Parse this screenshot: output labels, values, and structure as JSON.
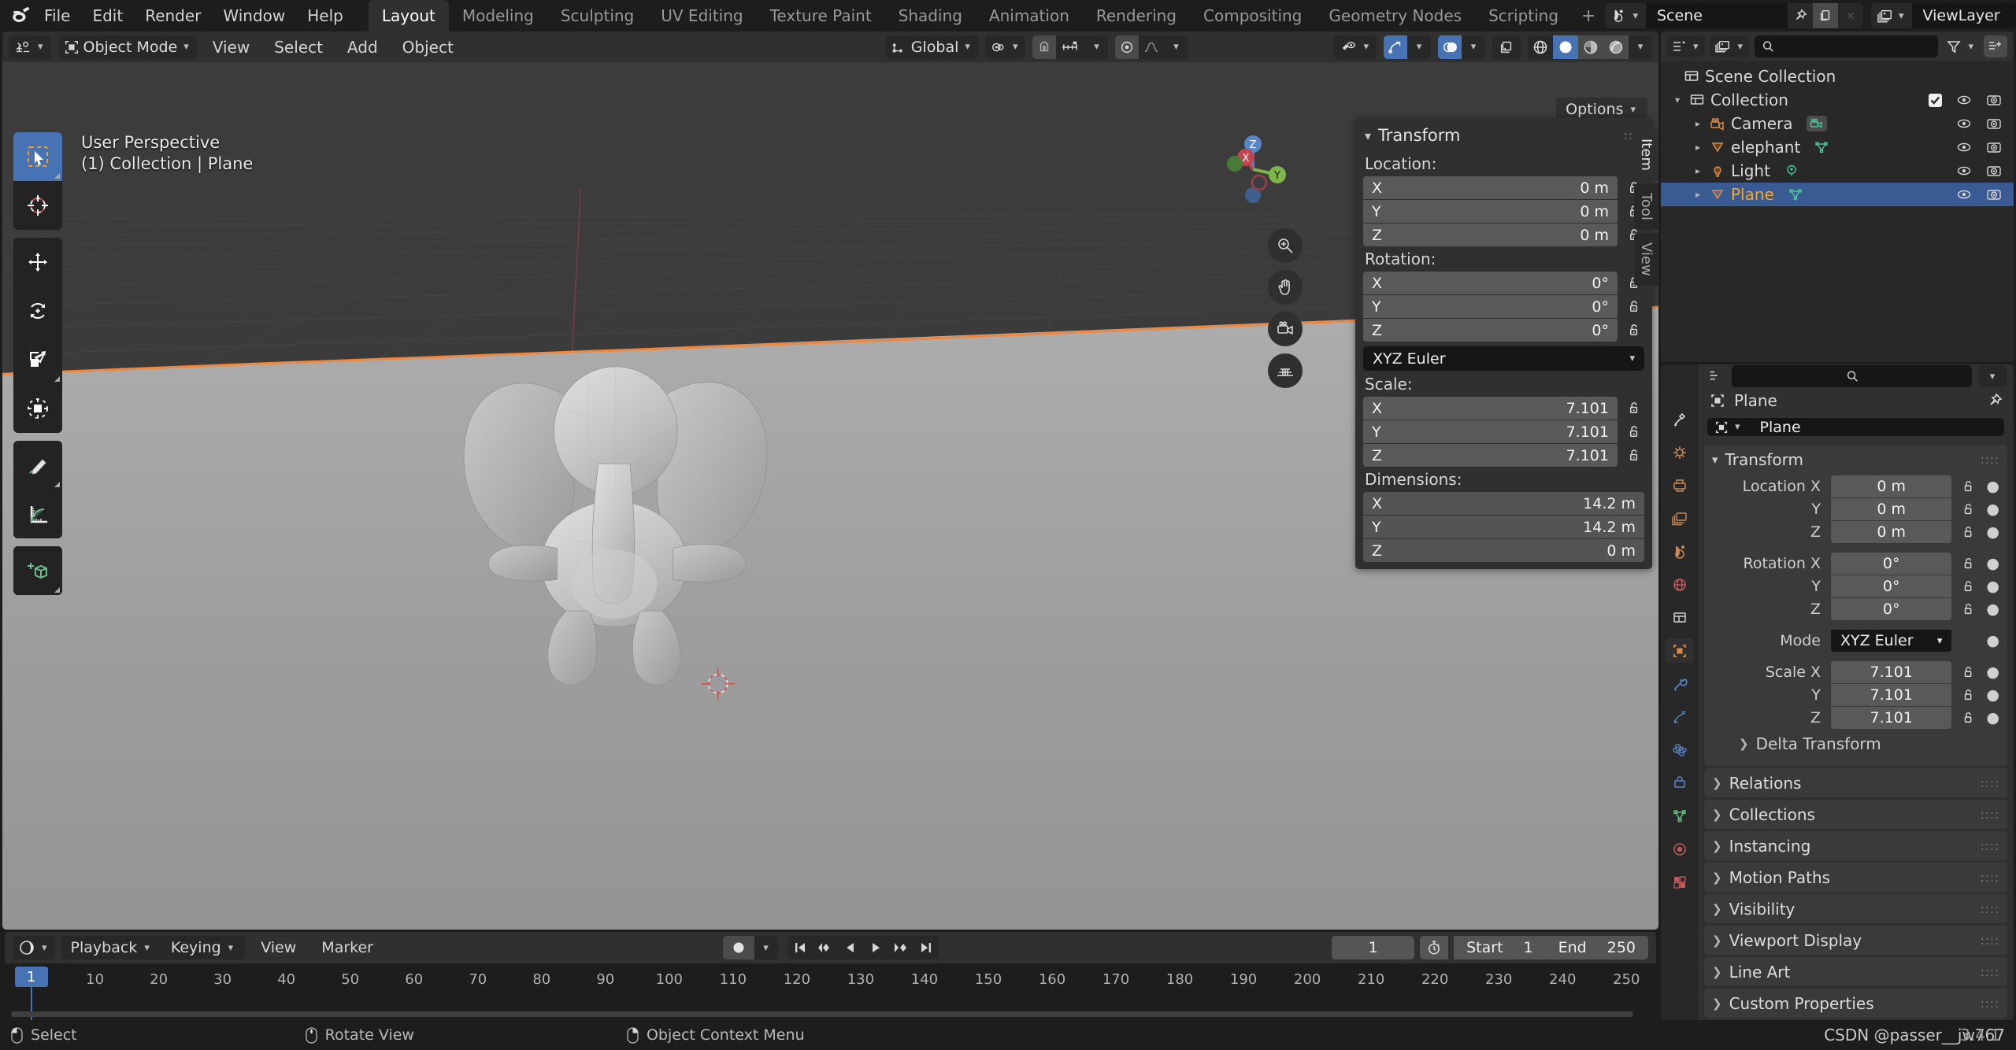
{
  "app": {
    "version": "3.4.1",
    "watermark": "CSDN @passer__jw767"
  },
  "topbar": {
    "logo_icon": "blender-logo-icon",
    "menus": [
      "File",
      "Edit",
      "Render",
      "Window",
      "Help"
    ],
    "workspaces": [
      "Layout",
      "Modeling",
      "Sculpting",
      "UV Editing",
      "Texture Paint",
      "Shading",
      "Animation",
      "Rendering",
      "Compositing",
      "Geometry Nodes",
      "Scripting"
    ],
    "active_workspace": "Layout",
    "add_workspace_label": "+",
    "scene": {
      "label": "Scene",
      "icon": "scene-icon",
      "pin_icon": "pin-icon",
      "copy_icon": "copy-icon",
      "close_icon": "x-icon"
    },
    "viewlayer": {
      "label": "ViewLayer",
      "icon": "viewlayer-icon",
      "copy_icon": "copy-icon",
      "close_icon": "x-icon"
    }
  },
  "viewport": {
    "header": {
      "editor_type_icon": "editor-type-3dview-icon",
      "mode": "Object Mode",
      "mode_icon": "object-mode-icon",
      "menus": [
        "View",
        "Select",
        "Add",
        "Object"
      ],
      "transform_orientation": {
        "label": "Global",
        "icon": "orientation-icon"
      },
      "pivot_icon": "pivot-point-icon",
      "snap_magnet_icon": "snap-magnet-icon",
      "snap_target_icon": "snap-increment-icon",
      "proportional_icon": "proportional-editing-icon",
      "falloff_icon": "falloff-curve-icon",
      "visibility_icon": "object-visibility-icon",
      "gizmo_icon": "gizmo-icon",
      "overlays_icon": "overlays-icon",
      "xray_icon": "xray-toggle-icon",
      "shading_modes": [
        "wireframe",
        "solid",
        "material-preview",
        "rendered"
      ],
      "active_shading": "solid"
    },
    "options_label": "Options",
    "overlay_line1": "User Perspective",
    "overlay_line2": "(1) Collection | Plane",
    "toolbar": [
      {
        "name": "tweak-select-tool",
        "icon": "cursor-arrow-box-icon",
        "active": true
      },
      {
        "name": "cursor-tool",
        "icon": "3d-cursor-icon",
        "active": false
      },
      {
        "name": "move-tool",
        "icon": "move-arrows-icon",
        "active": false
      },
      {
        "name": "rotate-tool",
        "icon": "rotate-arrows-icon",
        "active": false
      },
      {
        "name": "scale-tool",
        "icon": "scale-box-icon",
        "active": false
      },
      {
        "name": "transform-tool",
        "icon": "transform-icon",
        "active": false
      },
      {
        "name": "annotate-tool",
        "icon": "pencil-icon",
        "active": false
      },
      {
        "name": "measure-tool",
        "icon": "ruler-icon",
        "active": false
      },
      {
        "name": "add-cube-tool",
        "icon": "add-cube-icon",
        "active": false
      }
    ],
    "side_buttons": [
      {
        "name": "zoom-view-button",
        "icon": "magnifier-icon"
      },
      {
        "name": "pan-view-button",
        "icon": "hand-icon"
      },
      {
        "name": "camera-view-button",
        "icon": "camera-icon"
      },
      {
        "name": "toggle-ortho-button",
        "icon": "grid-perspective-icon"
      }
    ],
    "gizmo": {
      "x_label": "X",
      "y_label": "Y",
      "z_label": "Z"
    }
  },
  "npanel": {
    "tabs": [
      "Item",
      "Tool",
      "View"
    ],
    "active_tab": "Item",
    "title": "Transform",
    "sections": [
      {
        "label": "Location:",
        "rows": [
          {
            "axis": "X",
            "value": "0 m"
          },
          {
            "axis": "Y",
            "value": "0 m"
          },
          {
            "axis": "Z",
            "value": "0 m"
          }
        ]
      },
      {
        "label": "Rotation:",
        "rows": [
          {
            "axis": "X",
            "value": "0°"
          },
          {
            "axis": "Y",
            "value": "0°"
          },
          {
            "axis": "Z",
            "value": "0°"
          }
        ]
      }
    ],
    "rotation_mode": "XYZ Euler",
    "scale_label": "Scale:",
    "scale_rows": [
      {
        "axis": "X",
        "value": "7.101"
      },
      {
        "axis": "Y",
        "value": "7.101"
      },
      {
        "axis": "Z",
        "value": "7.101"
      }
    ],
    "dimensions_label": "Dimensions:",
    "dimension_rows": [
      {
        "axis": "X",
        "value": "14.2 m"
      },
      {
        "axis": "Y",
        "value": "14.2 m"
      },
      {
        "axis": "Z",
        "value": "0 m"
      }
    ]
  },
  "outliner": {
    "editor_icon": "outliner-icon",
    "display_mode_icon": "view-layer-icon",
    "search_placeholder": "",
    "filter_icon": "funnel-icon",
    "new_collection_icon": "new-collection-icon",
    "root": {
      "label": "Scene Collection",
      "icon": "scene-collection-icon"
    },
    "rows": [
      {
        "label": "Collection",
        "icon": "collection-icon",
        "indent": 1,
        "disclosure": "down",
        "checkbox": true,
        "eye": true,
        "camera": true,
        "selected": false,
        "data_icon": ""
      },
      {
        "label": "Camera",
        "icon": "camera-object-icon",
        "indent": 2,
        "disclosure": "right",
        "checkbox": false,
        "eye": true,
        "camera": true,
        "selected": false,
        "data_icon": "camera-data-icon"
      },
      {
        "label": "elephant",
        "icon": "mesh-object-icon",
        "indent": 2,
        "disclosure": "right",
        "checkbox": false,
        "eye": true,
        "camera": true,
        "selected": false,
        "data_icon": "mesh-data-icon"
      },
      {
        "label": "Light",
        "icon": "light-object-icon",
        "indent": 2,
        "disclosure": "right",
        "checkbox": false,
        "eye": true,
        "camera": true,
        "selected": false,
        "data_icon": "light-data-icon"
      },
      {
        "label": "Plane",
        "icon": "mesh-object-icon",
        "indent": 2,
        "disclosure": "right",
        "checkbox": false,
        "eye": true,
        "camera": true,
        "selected": true,
        "data_icon": "mesh-data-icon"
      }
    ]
  },
  "properties": {
    "search_icon": "search-icon",
    "editor_icon": "properties-editor-icon",
    "tabs": [
      {
        "name": "tool",
        "icon": "tool-icon",
        "active": false
      },
      {
        "name": "render",
        "icon": "render-icon",
        "active": false
      },
      {
        "name": "output",
        "icon": "printer-icon",
        "active": false
      },
      {
        "name": "view-layer",
        "icon": "images-icon",
        "active": false
      },
      {
        "name": "scene",
        "icon": "scene-cone-icon",
        "active": false
      },
      {
        "name": "world",
        "icon": "world-globe-icon",
        "active": false
      },
      {
        "name": "collection",
        "icon": "box-icon",
        "active": false
      },
      {
        "name": "object",
        "icon": "object-square-icon",
        "active": true
      },
      {
        "name": "modifiers",
        "icon": "wrench-icon",
        "active": false
      },
      {
        "name": "particles",
        "icon": "particles-icon",
        "active": false
      },
      {
        "name": "physics",
        "icon": "physics-orbit-icon",
        "active": false
      },
      {
        "name": "constraints",
        "icon": "constraints-icon",
        "active": false
      },
      {
        "name": "data",
        "icon": "green-triangle-data-icon",
        "active": false
      },
      {
        "name": "material",
        "icon": "material-sphere-icon",
        "active": false
      },
      {
        "name": "texture",
        "icon": "checker-texture-icon",
        "active": false
      }
    ],
    "breadcrumb": "Plane",
    "breadcrumb_icon": "object-square-icon",
    "pin_icon": "pin-icon",
    "object_name": "Plane",
    "panel_title": "Transform",
    "rows": [
      {
        "label": "Location X",
        "value": "0 m"
      },
      {
        "label": "Y",
        "value": "0 m"
      },
      {
        "label": "Z",
        "value": "0 m"
      }
    ],
    "rotation_rows": [
      {
        "label": "Rotation X",
        "value": "0°"
      },
      {
        "label": "Y",
        "value": "0°"
      },
      {
        "label": "Z",
        "value": "0°"
      }
    ],
    "mode_label": "Mode",
    "mode_value": "XYZ Euler",
    "scale_rows": [
      {
        "label": "Scale X",
        "value": "7.101"
      },
      {
        "label": "Y",
        "value": "7.101"
      },
      {
        "label": "Z",
        "value": "7.101"
      }
    ],
    "delta_transform": "Delta Transform",
    "collapsed_panels": [
      "Relations",
      "Collections",
      "Instancing",
      "Motion Paths",
      "Visibility",
      "Viewport Display",
      "Line Art",
      "Custom Properties"
    ]
  },
  "timeline": {
    "editor_icon": "timeline-editor-icon",
    "menus": [
      "Playback",
      "Keying"
    ],
    "plain_menus": [
      "View",
      "Marker"
    ],
    "record_icon": "record-circle-icon",
    "transport": [
      "jump-to-start-icon",
      "jump-to-prev-keyframe-icon",
      "play-reverse-icon",
      "play-icon",
      "jump-to-next-keyframe-icon",
      "jump-to-end-icon"
    ],
    "current_frame": "1",
    "stopwatch_icon": "stopwatch-icon",
    "start_label": "Start",
    "start_value": "1",
    "end_label": "End",
    "end_value": "250",
    "ticks": [
      "1",
      "10",
      "20",
      "30",
      "40",
      "50",
      "60",
      "70",
      "80",
      "90",
      "100",
      "110",
      "120",
      "130",
      "140",
      "150",
      "160",
      "170",
      "180",
      "190",
      "200",
      "210",
      "220",
      "230",
      "240",
      "250"
    ],
    "playhead_frame": "1"
  },
  "statusbar": {
    "items": [
      {
        "icon": "mouse-left-icon",
        "label": "Select"
      },
      {
        "icon": "mouse-middle-icon",
        "label": "Rotate View"
      },
      {
        "icon": "mouse-right-icon",
        "label": "Object Context Menu"
      }
    ]
  }
}
